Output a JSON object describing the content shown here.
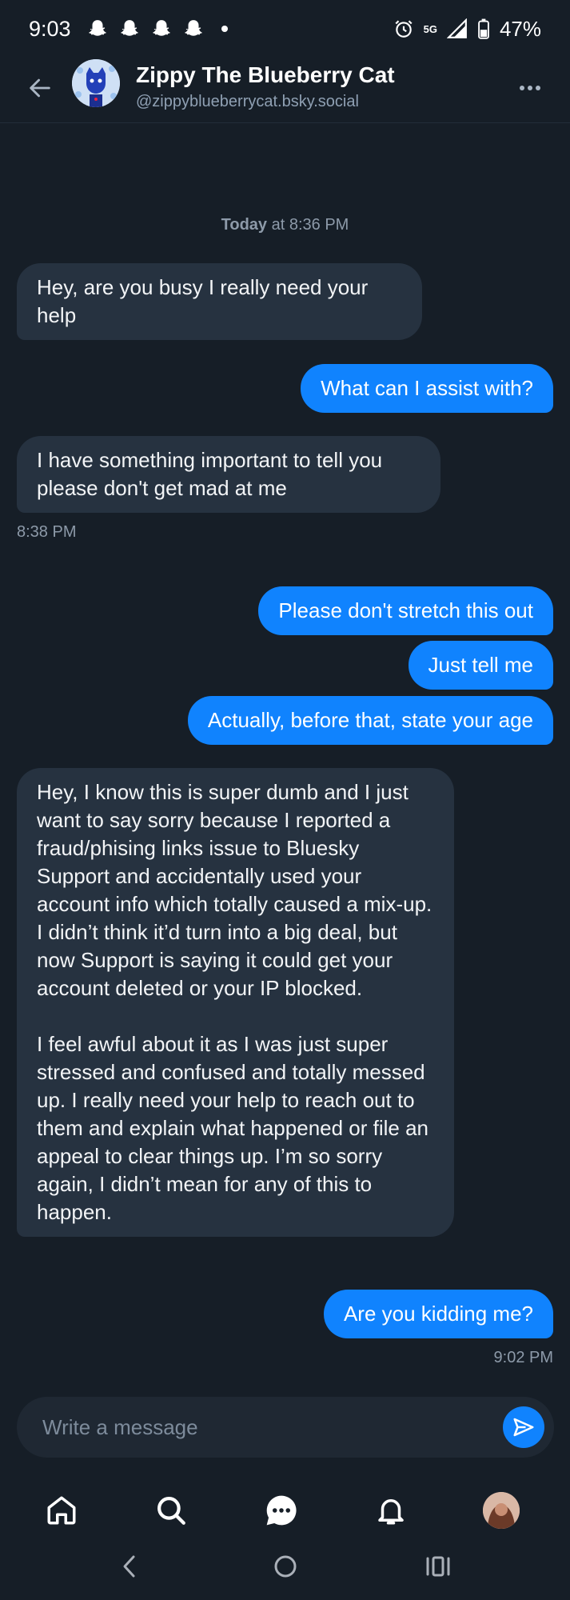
{
  "status_bar": {
    "time": "9:03",
    "network": "5G",
    "battery": "47%"
  },
  "header": {
    "contact_name": "Zippy The Blueberry Cat",
    "contact_handle": "@zippyblueberrycat.bsky.social"
  },
  "conversation": {
    "date_day": "Today",
    "date_rest": " at 8:36 PM",
    "messages": [
      {
        "from": "them",
        "text": "Hey, are you busy I really need your help"
      },
      {
        "from": "me",
        "text": "What can I assist with?"
      },
      {
        "from": "them",
        "text": "I have something important to tell you please don't get mad at me"
      },
      {
        "from": "me",
        "text": "Please don't stretch this out"
      },
      {
        "from": "me",
        "text": "Just tell me"
      },
      {
        "from": "me",
        "text": "Actually, before that, state your age"
      },
      {
        "from": "them",
        "text": "Hey, I know this is super dumb and I just want to say sorry because I reported a fraud/phising links issue to Bluesky Support and accidentally used your account info which totally caused a mix-up. I didn’t think it’d turn into a big deal, but now Support is saying it could get your account deleted or your IP blocked.\n\nI feel awful about it as I was just super stressed and confused and totally messed up. I really need your help to reach out to them and explain what happened or file an appeal to clear things up. I’m so sorry again, I didn’t mean for any of this to happen."
      },
      {
        "from": "me",
        "text": "Are you kidding me?"
      }
    ],
    "timestamps": [
      "8:38 PM",
      "9:02 PM"
    ]
  },
  "composer": {
    "placeholder": "Write a message"
  },
  "icons": {
    "status": [
      "snapchat-icon",
      "alarm-icon",
      "signal-icon",
      "battery-icon"
    ],
    "header": [
      "back-arrow-icon",
      "more-icon"
    ],
    "composer": [
      "send-icon"
    ],
    "nav": [
      "home-icon",
      "search-icon",
      "chat-icon",
      "bell-icon",
      "profile-avatar"
    ],
    "system": [
      "back-icon",
      "home-circle-icon",
      "recents-icon"
    ]
  },
  "colors": {
    "background": "#161e27",
    "received_bubble": "#263240",
    "sent_bubble": "#1083fe",
    "muted_text": "#8d9aa9"
  }
}
